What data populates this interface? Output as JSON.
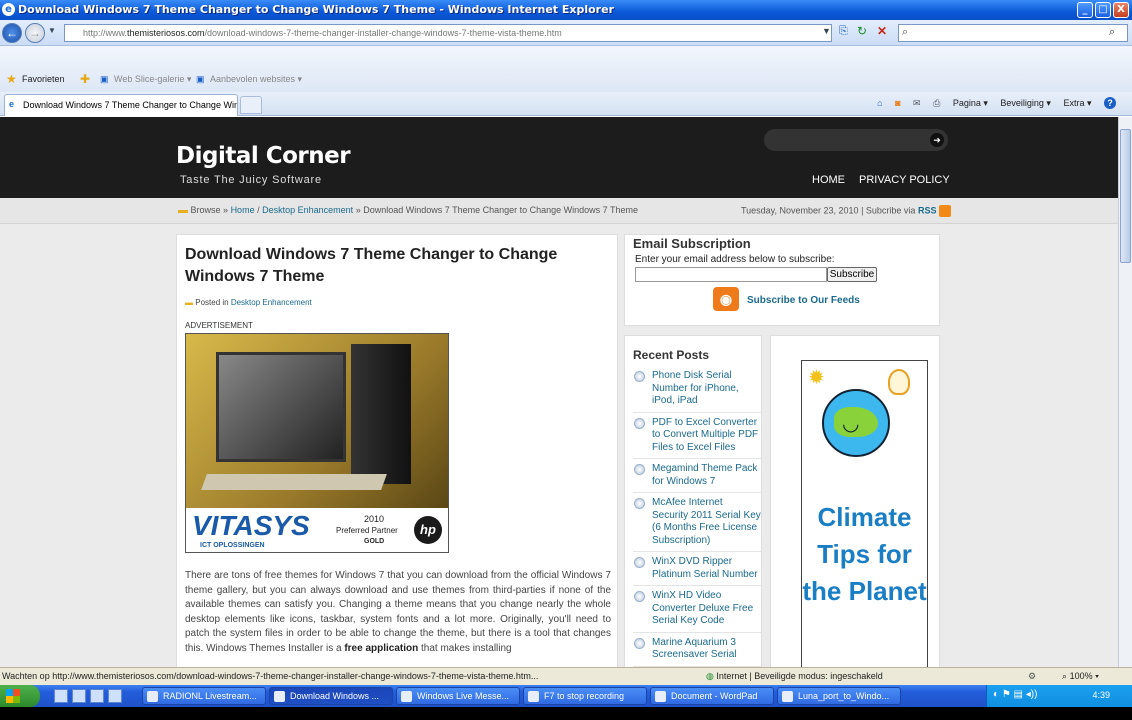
{
  "window": {
    "title": "Download Windows 7 Theme Changer to Change Windows 7 Theme - Windows Internet Explorer",
    "minimize": "_",
    "maximize": "□",
    "close": "X"
  },
  "address": {
    "url_prefix": "http://www.",
    "url_domain": "themisteriosos.com",
    "url_path": "/download-windows-7-theme-changer-installer-change-windows-7-theme-vista-theme.htm"
  },
  "favorites": {
    "favorites_label": "Favorieten",
    "web_slice": "Web Slice-galerie ▾",
    "suggested": "Aanbevolen websites ▾"
  },
  "tabs": [
    {
      "label": "Download Windows 7 Theme Changer to Change Win..."
    }
  ],
  "commandbar": {
    "page": "Pagina ▾",
    "security": "Beveiliging ▾",
    "extra": "Extra ▾",
    "help": "?"
  },
  "site": {
    "logo": "Digital Corner",
    "tagline": "Taste The Juicy Software",
    "nav": {
      "home": "HOME",
      "privacy": "PRIVACY POLICY"
    },
    "breadcrumb": {
      "browse": "Browse »",
      "home": "Home",
      "category": "Desktop Enhancement",
      "current": "» Download Windows 7 Theme Changer to Change Windows 7 Theme",
      "sep": "/"
    },
    "date_line": "Tuesday, November 23, 2010 | Subcribe via",
    "rss": "RSS"
  },
  "article": {
    "title": "Download Windows 7 Theme Changer to Change Windows 7 Theme",
    "posted_in": "Posted in",
    "category": "Desktop Enhancement",
    "ad_label": "ADVERTISEMENT",
    "ad": {
      "brand": "VITASYS",
      "sub": "ICT OPLOSSINGEN",
      "year": "2010",
      "partner": "Preferred Partner",
      "gold": "GOLD",
      "hp": "hp"
    },
    "body_1": "There are tons of free themes for Windows 7 that you can download from the official Windows 7 theme gallery, but you can always download and use themes from third-parties if none of the available themes can satisfy you. Changing a theme means that you change nearly the whole desktop elements like icons, taskbar, system fonts and a lot more. Originally, you'll need to patch the system files in order to be able to change the theme, but there is a tool that changes this. Windows Themes Installer is a",
    "body_bold": "free application",
    "body_2": "that makes installing"
  },
  "sidebar": {
    "email_title": "Email Subscription",
    "email_prompt": "Enter your email address below to subscribe:",
    "subscribe_button": "Subscribe",
    "feeds_link": "Subscribe to Our Feeds",
    "recent_title": "Recent Posts",
    "recent_posts": [
      "Phone Disk Serial Number for iPhone, iPod, iPad",
      "PDF to Excel Converter to Convert Multiple PDF Files to Excel Files",
      "Megamind Theme Pack for Windows 7",
      "McAfee Internet Security 2011 Serial Key (6 Months Free License Subscription)",
      "WinX DVD Ripper Platinum Serial Number",
      "WinX HD Video Converter Deluxe Free Serial Key Code",
      "Marine Aquarium 3 Screensaver Serial"
    ],
    "climate_ad": "Climate Tips for the Planet"
  },
  "status": {
    "loading": "Wachten op http://www.themisteriosos.com/download-windows-7-theme-changer-installer-change-windows-7-theme-vista-theme.htm...",
    "zone": "Internet | Beveiligde modus: ingeschakeld",
    "zoom": "100%"
  },
  "taskbar": {
    "items": [
      "RADIONL Livestream...",
      "Download Windows ...",
      "Windows Live Messe...",
      "F7 to stop recording",
      "Document - WordPad",
      "Luna_port_to_Windo..."
    ],
    "clock": "4:39"
  }
}
